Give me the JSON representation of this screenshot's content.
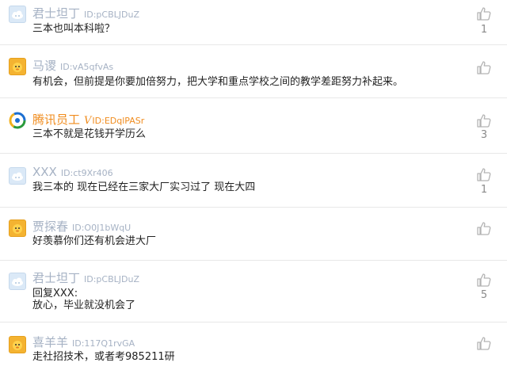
{
  "comments": [
    {
      "name": "君士坦丁",
      "id": "ID:pCBLJDuZ",
      "text": "三本也叫本科啦？",
      "likes": "1",
      "avatar": "cloud",
      "vip": false
    },
    {
      "name": "马谡",
      "id": "ID:vA5qfvAs",
      "text": "有机会，但前提是你要加倍努力，把大学和重点学校之间的教学差距努力补起来。",
      "likes": "",
      "avatar": "duck",
      "vip": false
    },
    {
      "name": "腾讯员工",
      "id": "ID:EDqlPASr",
      "vmark": "V",
      "text": "三本不就是花钱开学历么",
      "likes": "3",
      "avatar": "tencent",
      "vip": true
    },
    {
      "name": "XXX",
      "id": "ID:ct9Xr406",
      "text": "我三本的 现在已经在三家大厂实习过了 现在大四",
      "likes": "1",
      "avatar": "cloud",
      "vip": false
    },
    {
      "name": "贾探春",
      "id": "ID:O0J1bWqU",
      "text": "好羡慕你们还有机会进大厂",
      "likes": "",
      "avatar": "duck",
      "vip": false
    },
    {
      "name": "君士坦丁",
      "id": "ID:pCBLJDuZ",
      "text": "回复XXX:",
      "text2": "放心，毕业就没机会了",
      "likes": "5",
      "avatar": "cloud",
      "vip": false
    },
    {
      "name": "喜羊羊",
      "id": "ID:117Q1rvGA",
      "text": "走社招技术，或者考985211研",
      "likes": "",
      "avatar": "duck",
      "vip": false
    }
  ],
  "colors": {
    "name": "#a6b2c4",
    "vip": "#f08c1e",
    "text": "#222222",
    "divider": "#e8e8e8",
    "like_icon": "#b3b3b3"
  },
  "icons": {
    "like": "thumbs-up-icon"
  }
}
